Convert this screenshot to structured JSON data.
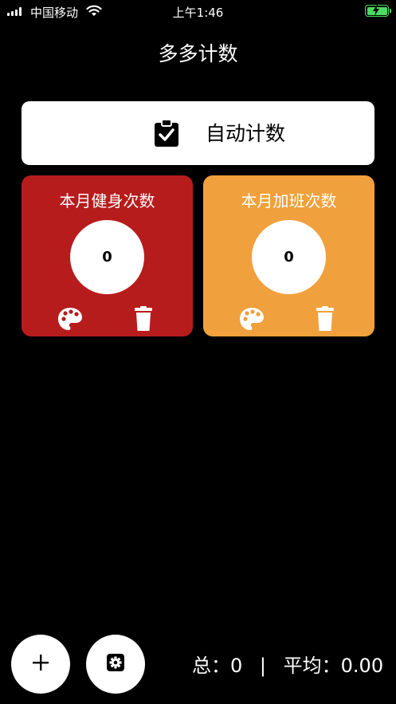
{
  "status_bar": {
    "carrier": "中国移动",
    "time": "上午1:46"
  },
  "page_title": "多多计数",
  "auto_count_button": {
    "label": "自动计数",
    "icon": "clipboard-check-icon"
  },
  "counters": [
    {
      "name": "本月健身次数",
      "value": "0",
      "color": "#b71c1c"
    },
    {
      "name": "本月加班次数",
      "value": "0",
      "color": "#f0a03c"
    }
  ],
  "footer": {
    "total_label": "总：",
    "total_value": "0",
    "separator": "|",
    "average_label": "平均：",
    "average_value": "0.00"
  },
  "colors": {
    "background": "#000000",
    "battery": "#4cd964"
  }
}
